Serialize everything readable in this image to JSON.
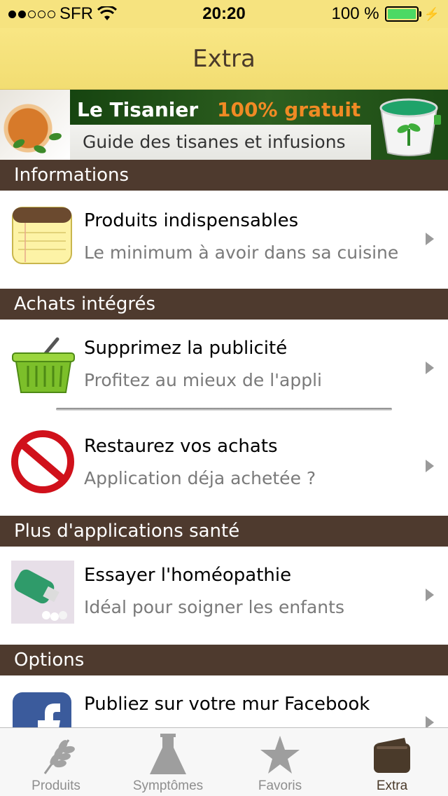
{
  "status_bar": {
    "carrier": "SFR",
    "time": "20:20",
    "battery": "100 %"
  },
  "nav": {
    "title": "Extra"
  },
  "banner": {
    "title": "Le Tisanier",
    "badge": "100% gratuit",
    "subtitle": "Guide des tisanes et infusions"
  },
  "sections": {
    "informations": "Informations",
    "achats": "Achats intégrés",
    "plus_apps": "Plus d'applications santé",
    "options": "Options"
  },
  "rows": {
    "produits": {
      "title": "Produits indispensables",
      "subtitle": "Le minimum à avoir dans sa cuisine"
    },
    "supprimez": {
      "title": "Supprimez la publicité",
      "subtitle": "Profitez au mieux de l'appli"
    },
    "restaurez": {
      "title": "Restaurez vos achats",
      "subtitle": "Application déja achetée ?"
    },
    "homeo": {
      "title": "Essayer l'homéopathie",
      "subtitle": "Idéal pour soigner les enfants"
    },
    "facebook": {
      "title": "Publiez sur votre mur Facebook"
    }
  },
  "tabs": [
    {
      "label": "Produits",
      "icon": "wheat-icon"
    },
    {
      "label": "Symptômes",
      "icon": "flask-icon"
    },
    {
      "label": "Favoris",
      "icon": "star-icon"
    },
    {
      "label": "Extra",
      "icon": "wallet-icon"
    }
  ],
  "colors": {
    "nav": "#f4e07a",
    "section": "#4e3a2e",
    "active_tab": "#4a3a2a",
    "inactive_tab": "#8e8e8e"
  }
}
